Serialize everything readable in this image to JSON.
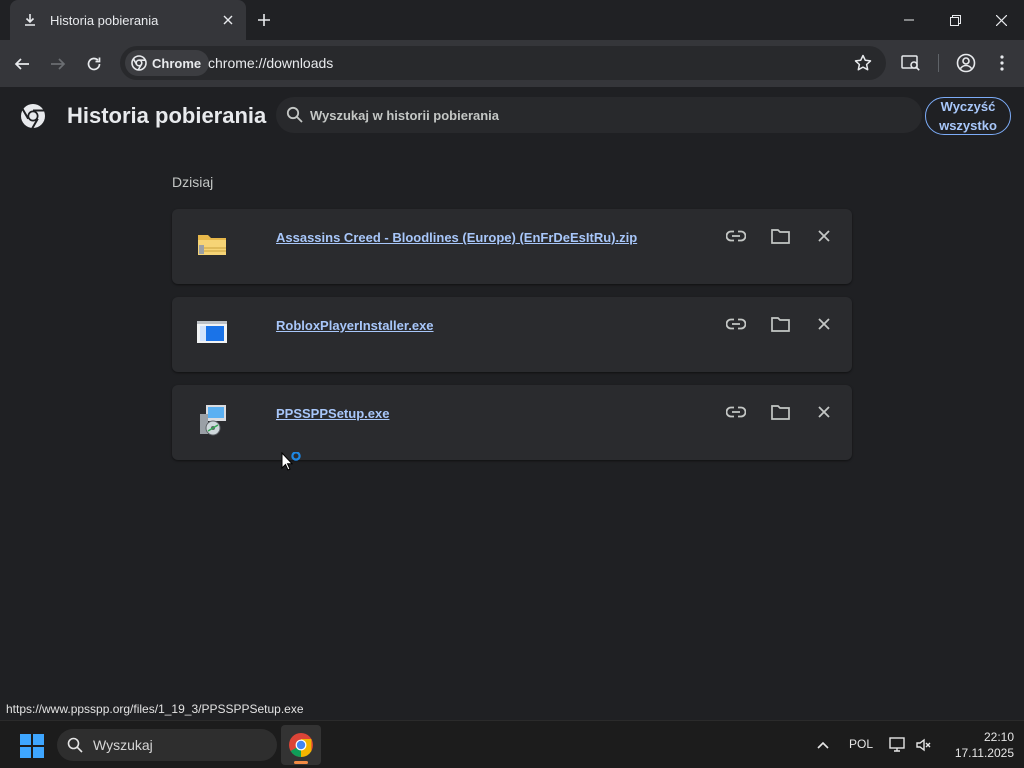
{
  "browser": {
    "tab": {
      "title": "Historia pobierania",
      "favicon": "download-icon"
    },
    "omnibox": {
      "chip_label": "Chrome",
      "url": "chrome://downloads"
    }
  },
  "page": {
    "title": "Historia pobierania",
    "search_placeholder": "Wyszukaj w historii pobierania",
    "clear_all_label": "Wyczyść wszystko",
    "section_label": "Dzisiaj",
    "downloads": [
      {
        "filename": "Assassins Creed - Bloodlines (Europe) (EnFrDeEsItRu).zip",
        "icon": "zip-folder-icon"
      },
      {
        "filename": "RobloxPlayerInstaller.exe",
        "icon": "exe-window-icon"
      },
      {
        "filename": "PPSSPPSetup.exe",
        "icon": "installer-icon"
      }
    ],
    "status_url": "https://www.ppsspp.org/files/1_19_3/PPSSPPSetup.exe"
  },
  "taskbar": {
    "search_label": "Wyszukaj",
    "language": "POL",
    "time": "22:10",
    "date": "17.11.2025"
  },
  "colors": {
    "accent": "#a8c7fa",
    "background": "#1f2023",
    "card": "#2a2b2e"
  }
}
